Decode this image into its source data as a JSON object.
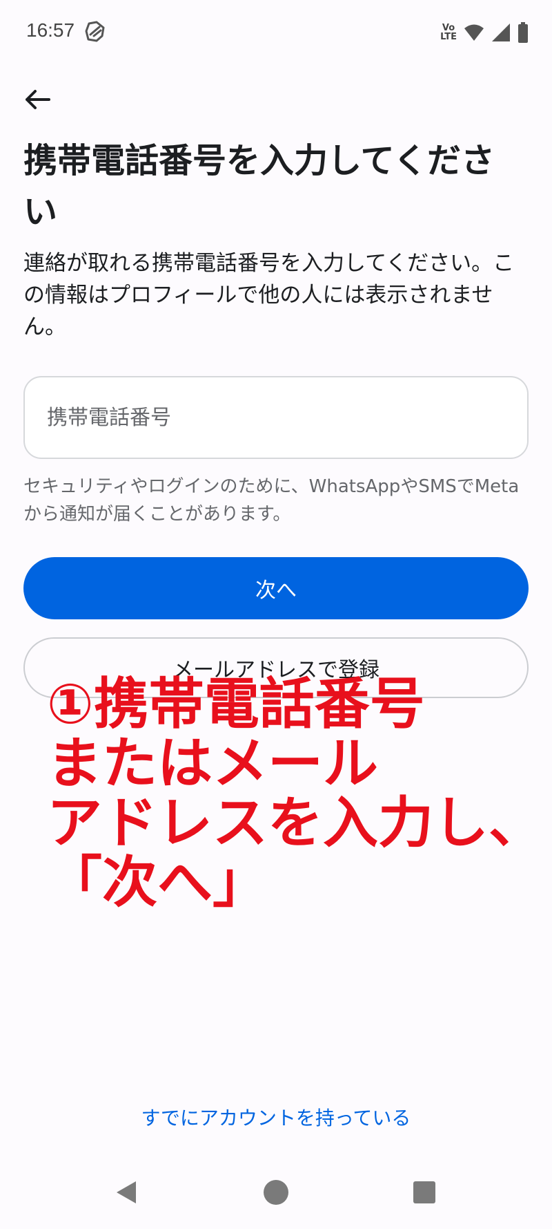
{
  "status_bar": {
    "time": "16:57",
    "network_label_top": "Vo",
    "network_label_bottom": "LTE",
    "icons": [
      "sync-app-icon",
      "volte-icon",
      "wifi-icon",
      "signal-icon",
      "battery-icon"
    ]
  },
  "header": {
    "back_icon": "arrow-left-icon"
  },
  "main": {
    "title": "携帯電話番号を入力してください",
    "description": "連絡が取れる携帯電話番号を入力してください。この情報はプロフィールで他の人には表示されません。",
    "phone_input": {
      "placeholder": "携帯電話番号",
      "value": ""
    },
    "helper_text": "セキュリティやログインのために、WhatsAppやSMSでMetaから通知が届くことがあります。",
    "next_button_label": "次へ",
    "email_button_label": "メールアドレスで登録",
    "existing_account_link": "すでにアカウントを持っている"
  },
  "annotation": {
    "text": "①携帯電話番号\nまたはメール\nアドレスを入力し、\n「次へ」",
    "color": "#e8101c"
  },
  "colors": {
    "primary": "#0064e0",
    "background": "#fdfbfe",
    "text": "#1c1e21",
    "secondary_text": "#65676b"
  },
  "nav_bar": {
    "icons": [
      "back-triangle-icon",
      "home-circle-icon",
      "recents-square-icon"
    ]
  }
}
